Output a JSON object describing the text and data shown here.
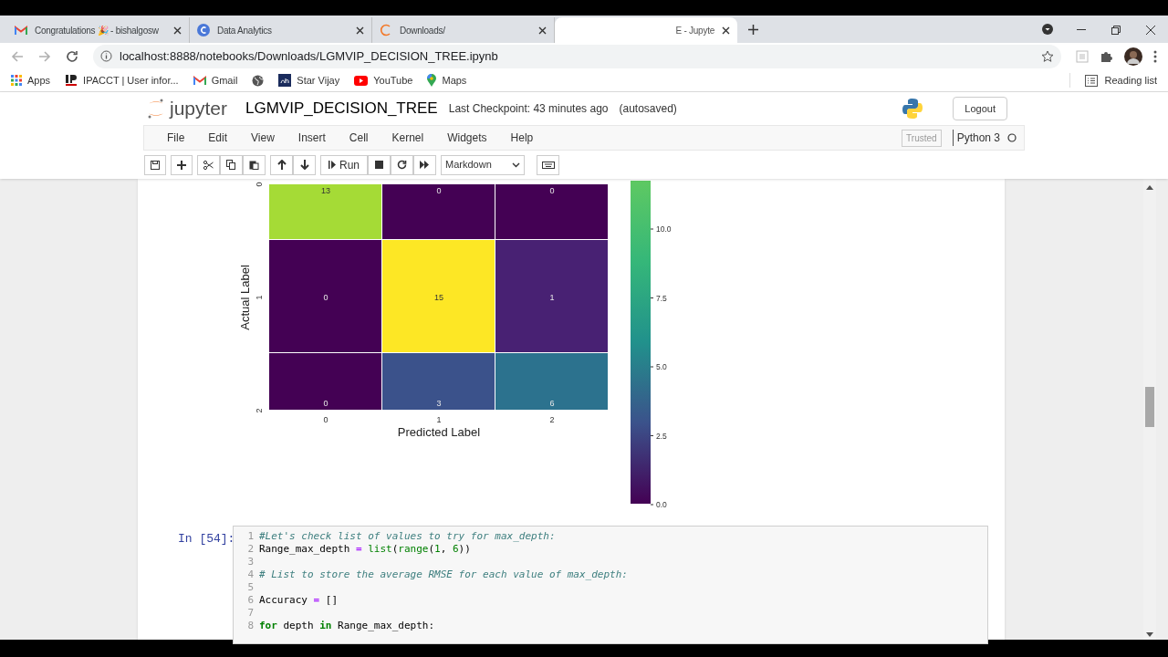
{
  "browser": {
    "tabs": [
      {
        "title": "Congratulations 🎉 - bishalgosw",
        "selected": false
      },
      {
        "title": "Data Analytics",
        "selected": false
      },
      {
        "title": "Downloads/",
        "selected": false
      },
      {
        "title": "E - Jupyte",
        "selected": true
      }
    ],
    "url": "localhost:8888/notebooks/Downloads/LGMVIP_DECISION_TREE.ipynb",
    "bookmarks": [
      {
        "label": "Apps"
      },
      {
        "label": "IPACCT | User infor..."
      },
      {
        "label": "Gmail"
      },
      {
        "kind": "icon"
      },
      {
        "label": "Star Vijay"
      },
      {
        "label": "YouTube"
      },
      {
        "label": "Maps"
      }
    ],
    "reading_list": "Reading list"
  },
  "jupyter": {
    "logo": "jupyter",
    "notebook": "LGMVIP_DECISION_TREE",
    "checkpoint": "Last Checkpoint: 43 minutes ago",
    "autosaved": "(autosaved)",
    "logout": "Logout",
    "menu": [
      "File",
      "Edit",
      "View",
      "Insert",
      "Cell",
      "Kernel",
      "Widgets",
      "Help"
    ],
    "trusted": "Trusted",
    "kernel": "Python 3",
    "run": "Run",
    "cell_type": "Markdown"
  },
  "heatmap": {
    "xlabel": "Predicted Label",
    "ylabel": "Actual Label",
    "xticks": [
      "0",
      "1",
      "2"
    ],
    "yticks": [
      "0",
      "1",
      "2"
    ],
    "cells": [
      [
        {
          "value": "13",
          "color": "#a5db36"
        },
        {
          "value": "0",
          "color": "#440154"
        },
        {
          "value": "0",
          "color": "#440154"
        }
      ],
      [
        {
          "value": "0",
          "color": "#440154"
        },
        {
          "value": "15",
          "color": "#fde725"
        },
        {
          "value": "1",
          "color": "#482173"
        }
      ],
      [
        {
          "value": "0",
          "color": "#440154"
        },
        {
          "value": "3",
          "color": "#3b528b"
        },
        {
          "value": "6",
          "color": "#2c728e"
        }
      ]
    ],
    "colorbar_ticks": [
      "10.0",
      "7.5",
      "5.0",
      "2.5",
      "0.0"
    ]
  },
  "code_cell": {
    "prompt": "In [54]:",
    "lines": [
      {
        "number": "1",
        "tokens": [
          {
            "text": "#Let's check list of values to try for max_depth:",
            "kind": "comment"
          }
        ]
      },
      {
        "number": "2",
        "tokens": [
          {
            "text": "Range_max_depth ",
            "kind": "name"
          },
          {
            "text": "=",
            "kind": "op"
          },
          {
            "text": " list",
            "kind": "builtin"
          },
          {
            "text": "(",
            "kind": "name"
          },
          {
            "text": "range",
            "kind": "builtin"
          },
          {
            "text": "(",
            "kind": "name"
          },
          {
            "text": "1",
            "kind": "number"
          },
          {
            "text": ", ",
            "kind": "name"
          },
          {
            "text": "6",
            "kind": "number"
          },
          {
            "text": "))",
            "kind": "name"
          }
        ]
      },
      {
        "number": "3"
      },
      {
        "number": "4",
        "tokens": [
          {
            "text": "# List to store the average RMSE for each value of max_depth:",
            "kind": "comment"
          }
        ]
      },
      {
        "number": "5"
      },
      {
        "number": "6",
        "tokens": [
          {
            "text": "Accuracy ",
            "kind": "name"
          },
          {
            "text": "=",
            "kind": "op"
          },
          {
            "text": " []",
            "kind": "name"
          }
        ]
      },
      {
        "number": "7"
      },
      {
        "number": "8",
        "tokens": [
          {
            "text": "for",
            "kind": "keyword"
          },
          {
            "text": " depth ",
            "kind": "name"
          },
          {
            "text": "in",
            "kind": "keyword"
          },
          {
            "text": " Range_max_depth:",
            "kind": "name"
          }
        ]
      }
    ]
  }
}
